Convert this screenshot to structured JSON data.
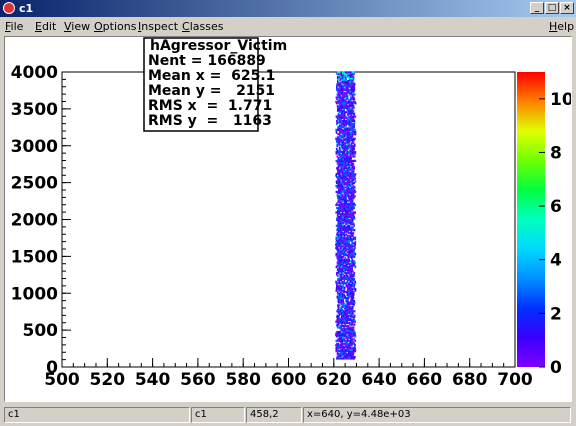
{
  "window": {
    "title": "c1"
  },
  "titlebar_buttons": {
    "minimize": "_",
    "maximize": "□",
    "close": "×"
  },
  "menu": {
    "file": "File",
    "edit": "Edit",
    "view": "View",
    "options": "Options",
    "inspect": "Inspect",
    "classes": "Classes",
    "help": "Help"
  },
  "stats": {
    "name": "hAgressor_Victim",
    "nent": "Nent = 166889",
    "mean_x": "Mean x =  625.1",
    "mean_y": "Mean y =   2151",
    "rms_x": "RMS x  =  1.771",
    "rms_y": "RMS y  =   1163"
  },
  "status": {
    "f1": "c1",
    "f2": "c1",
    "f3": "458,2",
    "f4": "x=640, y=4.48e+03"
  },
  "palette": {
    "colors": [
      "#7f00ff",
      "#4b00ff",
      "#1a1aff",
      "#0060ff",
      "#00a8ff",
      "#00e0ff",
      "#00ffb0",
      "#00ff40",
      "#40ff00",
      "#b0ff00",
      "#ffff00",
      "#ffb000",
      "#ff5000",
      "#ff0000"
    ]
  },
  "chart_data": {
    "type": "heatmap",
    "title": "",
    "xlabel": "",
    "ylabel": "",
    "xlim": [
      500,
      700
    ],
    "ylim": [
      0,
      4000
    ],
    "x_ticks": [
      "500",
      "520",
      "540",
      "560",
      "580",
      "600",
      "620",
      "640",
      "660",
      "680",
      "700"
    ],
    "y_ticks": [
      "0",
      "500",
      "1000",
      "1500",
      "2000",
      "2500",
      "3000",
      "3500",
      "4000"
    ],
    "z_ticks": [
      "0",
      "2",
      "4",
      "6",
      "8",
      "10"
    ],
    "zlim": [
      0,
      11
    ],
    "band": {
      "x_center": 625.1,
      "x_rms": 1.771,
      "y_min": 100,
      "y_max": 4000
    }
  }
}
